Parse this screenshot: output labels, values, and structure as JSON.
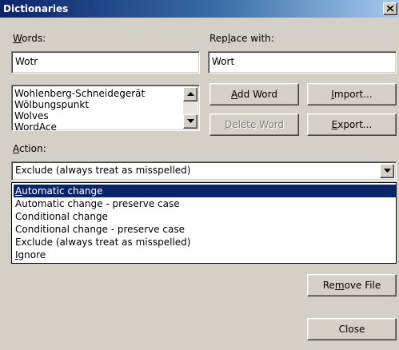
{
  "window": {
    "title": "Dictionaries"
  },
  "words": {
    "label": "Words:",
    "value": "Wotr"
  },
  "replace": {
    "label": "Replace with:",
    "value": "Wort"
  },
  "word_list": [
    "Wohlenberg-Schneidegerät",
    "Wölbungspunkt",
    "Wolves",
    "WordAce"
  ],
  "buttons": {
    "add_word": "Add Word",
    "delete_word": "Delete Word",
    "import": "Import...",
    "export": "Export...",
    "remove_file": "Remove File",
    "close": "Close"
  },
  "action": {
    "label": "Action:",
    "selected": "Exclude (always treat as misspelled)",
    "options": [
      "Automatic change",
      "Automatic change - preserve case",
      "Conditional change",
      "Conditional change - preserve case",
      "Exclude (always treat as misspelled)",
      "Ignore"
    ],
    "highlighted_option": "Automatic change"
  },
  "icons": {
    "close": "close-icon",
    "scroll_up": "arrow-up-icon",
    "scroll_down": "arrow-down-icon",
    "dropdown": "arrow-down-icon"
  }
}
